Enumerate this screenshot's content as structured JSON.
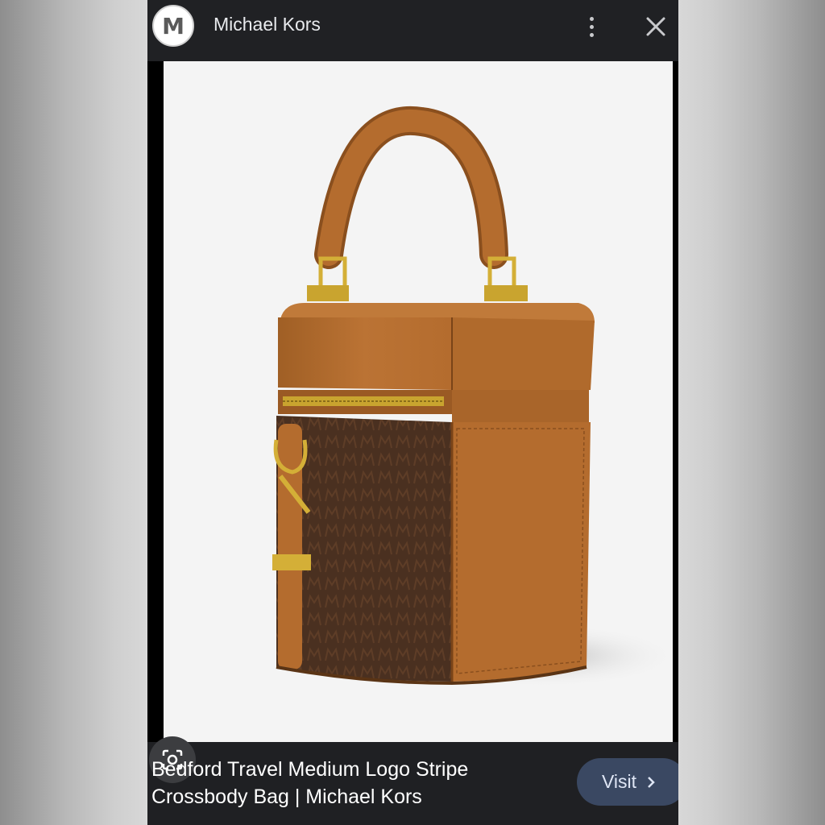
{
  "header": {
    "avatar_letter": "M",
    "site_name": "Michael Kors",
    "more_icon": "more-vert-icon",
    "close_icon": "close-icon"
  },
  "image": {
    "alt": "Bedford Travel Medium Logo Stripe Crossbody Bag"
  },
  "lens_icon": "google-lens-icon",
  "caption": {
    "title": "Bedford Travel Medium Logo Stripe Crossbody Bag | Michael Kors"
  },
  "visit": {
    "label": "Visit",
    "icon": "chevron-right-icon"
  },
  "colors": {
    "background": "#202124",
    "visit_bg": "#3a4862",
    "leather": "#b06a2c",
    "monogram": "#4a3020",
    "hardware": "#d4af37"
  }
}
